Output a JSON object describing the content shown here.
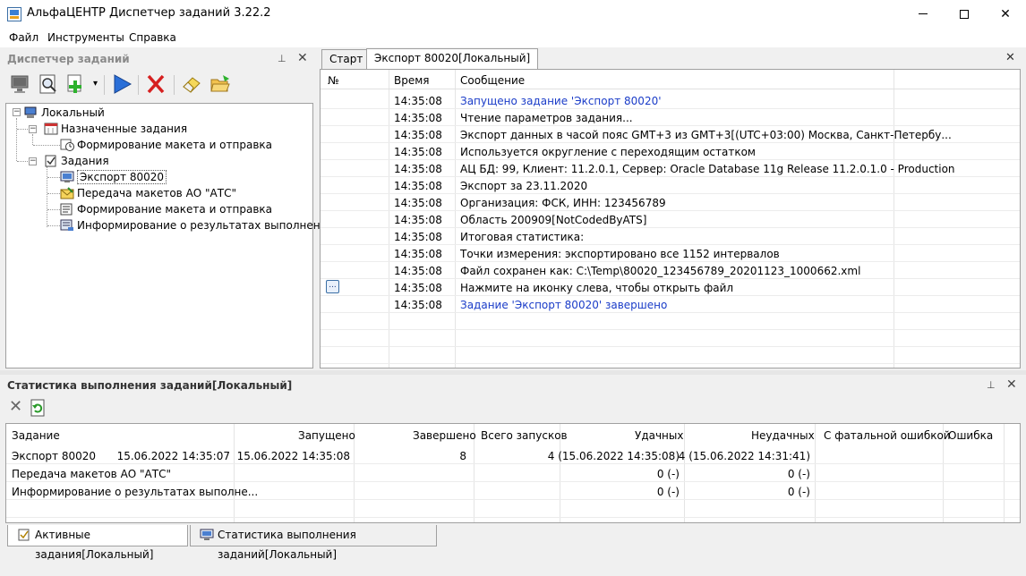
{
  "window": {
    "title": "АльфаЦЕНТР Диспетчер заданий 3.22.2",
    "minimize": "",
    "maximize": "",
    "close": "✕"
  },
  "menu": [
    "Файл",
    "Инструменты",
    "Справка"
  ],
  "task_manager_panel": {
    "title": "Диспетчер заданий",
    "pin": "⊥",
    "close": "✕",
    "toolbar_icons": [
      "monitor-icon",
      "magnify-icon",
      "add-icon",
      "dropdown-arrow-icon",
      "run-icon",
      "delete-icon",
      "eraser-icon",
      "folder-icon"
    ],
    "dropdown_arrow": "▾",
    "tree": {
      "root": "Локальный",
      "scheduled": "Назначенные задания",
      "scheduled_children": [
        "Формирование макета и отправка"
      ],
      "tasks": "Задания",
      "task_children": [
        "Экспорт 80020",
        "Передача макетов АО \"АТС\"",
        "Формирование макета и отправка",
        "Информирование о результатах выполнения"
      ]
    }
  },
  "tabs": [
    "Старт",
    "Экспорт 80020[Локальный]"
  ],
  "tabs_close": "✕",
  "log": {
    "columns": [
      "№",
      "Время",
      "Сообщение"
    ],
    "rows": [
      {
        "time": "14:35:08",
        "msg": "Запущено задание 'Экспорт 80020'",
        "blue": true
      },
      {
        "time": "14:35:08",
        "msg": "Чтение параметров задания..."
      },
      {
        "time": "14:35:08",
        "msg": "Экспорт данных в часой пояс GMT+3 из GMT+3[(UTC+03:00) Москва, Санкт-Петербу..."
      },
      {
        "time": "14:35:08",
        "msg": "Используется округление с переходящим остатком"
      },
      {
        "time": "14:35:08",
        "msg": "АЦ БД: 99, Клиент: 11.2.0.1, Сервер: Oracle Database 11g Release 11.2.0.1.0 - Production"
      },
      {
        "time": "14:35:08",
        "msg": "Экспорт за 23.11.2020"
      },
      {
        "time": "14:35:08",
        "msg": "Организация: ФСК, ИНН: 123456789"
      },
      {
        "time": "14:35:08",
        "msg": "Область 200909[NotCodedByATS]"
      },
      {
        "time": "14:35:08",
        "msg": "Итоговая статистика:"
      },
      {
        "time": "14:35:08",
        "msg": "Точки измерения: экспортировано все 1152 интервалов"
      },
      {
        "time": "14:35:08",
        "msg": "Файл сохранен как: C:\\Temp\\80020_123456789_20201123_1000662.xml"
      },
      {
        "time": "14:35:08",
        "msg": "Нажмите на иконку слева, чтобы открыть файл",
        "file_button": "..."
      },
      {
        "time": "14:35:08",
        "msg": "Задание 'Экспорт 80020' завершено",
        "blue": true
      }
    ]
  },
  "stats_panel": {
    "title": "Статистика выполнения заданий[Локальный]",
    "pin": "⊥",
    "close": "✕",
    "clear_icon": "✕",
    "columns": [
      "Задание",
      "Запущено",
      "Завершено",
      "Всего запусков",
      "Удачных",
      "Неудачных",
      "С фатальной ошибкой",
      "Ошибка"
    ],
    "rows": [
      [
        "Экспорт 80020",
        "15.06.2022 14:35:07",
        "15.06.2022 14:35:08",
        "8",
        "4 (15.06.2022 14:35:08)",
        "4 (15.06.2022 14:31:41)",
        "",
        ""
      ],
      [
        "Передача макетов АО \"АТС\"",
        "",
        "",
        "",
        "0 (-)",
        "0 (-)",
        "",
        ""
      ],
      [
        "Информирование о результатах выполне...",
        "",
        "",
        "",
        "0 (-)",
        "0 (-)",
        "",
        ""
      ]
    ]
  },
  "bottom_tabs": [
    "Активные задания[Локальный]",
    "Статистика выполнения заданий[Локальный]"
  ]
}
